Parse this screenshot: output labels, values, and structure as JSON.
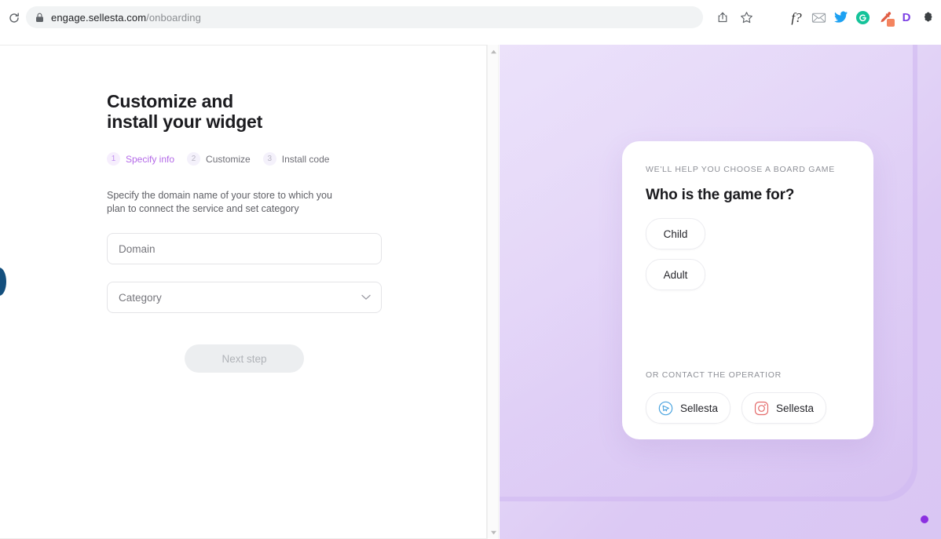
{
  "browser": {
    "reload_icon": "reload-icon",
    "lock_icon": "lock-icon",
    "url_host": "engage.sellesta.com",
    "url_path": "/onboarding",
    "actions": [
      {
        "name": "share-icon",
        "label": "Share"
      },
      {
        "name": "bookmark-star-icon",
        "label": "Bookmark"
      }
    ],
    "extensions": [
      {
        "name": "fnq-extension-icon",
        "label": "f?"
      },
      {
        "name": "mail-extension-icon",
        "label": ""
      },
      {
        "name": "twitter-extension-icon",
        "label": ""
      },
      {
        "name": "grammarly-extension-icon",
        "label": "G"
      },
      {
        "name": "eyedropper-extension-icon",
        "label": ""
      },
      {
        "name": "d-extension-icon",
        "label": "D"
      },
      {
        "name": "extensions-puzzle-icon",
        "label": ""
      }
    ]
  },
  "onboarding": {
    "title_line1": "Customize and",
    "title_line2": "install your widget",
    "steps": [
      {
        "num": "1",
        "label": "Specify info",
        "active": true
      },
      {
        "num": "2",
        "label": "Customize",
        "active": false
      },
      {
        "num": "3",
        "label": "Install code",
        "active": false
      }
    ],
    "description": "Specify the domain name of your store to which you plan to connect the service and set category",
    "fields": {
      "domain": {
        "placeholder": "Domain",
        "value": ""
      },
      "category": {
        "placeholder": "Category",
        "value": ""
      }
    },
    "next_button": "Next step"
  },
  "preview_widget": {
    "eyebrow": "WE'LL HELP YOU CHOOSE A BOARD GAME",
    "question": "Who is the game for?",
    "options": [
      {
        "label": "Child"
      },
      {
        "label": "Adult"
      }
    ],
    "contact_label": "OR CONTACT THE OPERATIOR",
    "contacts": [
      {
        "icon": "telegram-icon",
        "label": "Sellesta",
        "color": "#4aa3df"
      },
      {
        "icon": "instagram-icon",
        "label": "Sellesta",
        "color": "#e46a6a"
      }
    ]
  },
  "colors": {
    "accent_purple": "#b46ae8",
    "preview_bg": "#ddcaf4",
    "dot": "#8b2fe0"
  }
}
